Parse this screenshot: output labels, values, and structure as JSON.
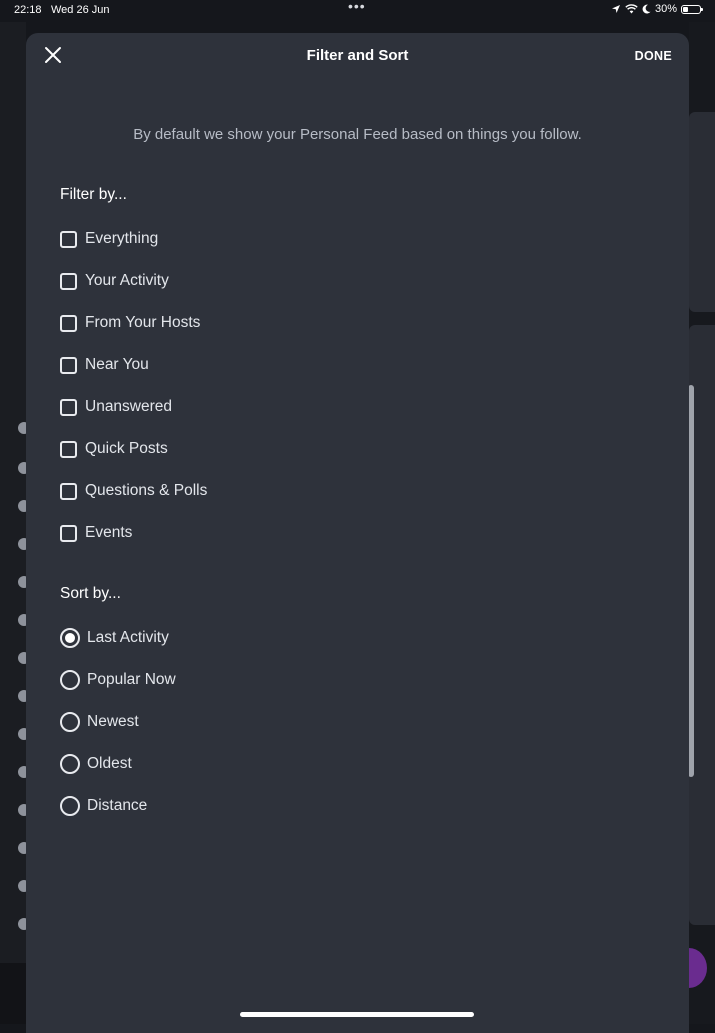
{
  "status_bar": {
    "time": "22:18",
    "date": "Wed 26 Jun",
    "battery": "30%",
    "battery_level": 0.3
  },
  "modal": {
    "title": "Filter and Sort",
    "done_label": "DONE",
    "close_icon": "close-icon",
    "intro": "By default we show your Personal Feed based on things you follow."
  },
  "filter": {
    "title": "Filter by...",
    "options": [
      {
        "label": "Everything",
        "checked": false
      },
      {
        "label": "Your Activity",
        "checked": false
      },
      {
        "label": "From Your Hosts",
        "checked": false
      },
      {
        "label": "Near You",
        "checked": false
      },
      {
        "label": "Unanswered",
        "checked": false
      },
      {
        "label": "Quick Posts",
        "checked": false
      },
      {
        "label": "Questions & Polls",
        "checked": false
      },
      {
        "label": "Events",
        "checked": false
      }
    ]
  },
  "sort": {
    "title": "Sort by...",
    "selected": "Last Activity",
    "options": [
      {
        "label": "Last Activity"
      },
      {
        "label": "Popular Now"
      },
      {
        "label": "Newest"
      },
      {
        "label": "Oldest"
      },
      {
        "label": "Distance"
      }
    ]
  },
  "colors": {
    "sheet_background": "#2e323b",
    "page_background": "#15171c",
    "text": "#ffffff",
    "muted_text": "#b7bcc6",
    "fab_accent": "#6a2c8f"
  }
}
